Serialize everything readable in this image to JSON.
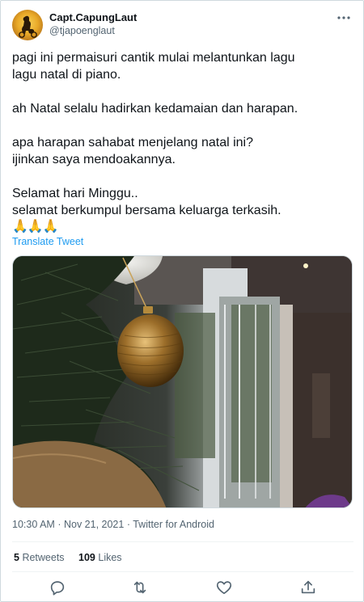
{
  "author": {
    "display_name": "Capt.CapungLaut",
    "handle": "@tjapoenglaut",
    "avatar_icon": "rider-avatar"
  },
  "tweet": {
    "paragraphs": [
      [
        "pagi ini permaisuri cantik mulai melantunkan lagu",
        "lagu natal di piano."
      ],
      [
        "ah Natal selalu hadirkan kedamaian dan harapan."
      ],
      [
        "apa harapan sahabat menjelang natal ini?",
        "ijinkan saya mendoakannya."
      ],
      [
        "Selamat hari Minggu..",
        "selamat berkumpul bersama keluarga terkasih."
      ]
    ],
    "emoji": "🙏🙏🙏",
    "translate_label": "Translate Tweet"
  },
  "meta": {
    "time": "10:30 AM",
    "separator": "·",
    "date": "Nov 21, 2021",
    "source": "Twitter for Android"
  },
  "stats": {
    "retweets_count": "5",
    "retweets_label": "Retweets",
    "likes_count": "109",
    "likes_label": "Likes"
  },
  "actions": [
    "reply-icon",
    "retweet-icon",
    "like-icon",
    "share-icon"
  ],
  "colors": {
    "link": "#1d9bf0",
    "secondary_text": "#536471",
    "border": "#cfd9de"
  }
}
